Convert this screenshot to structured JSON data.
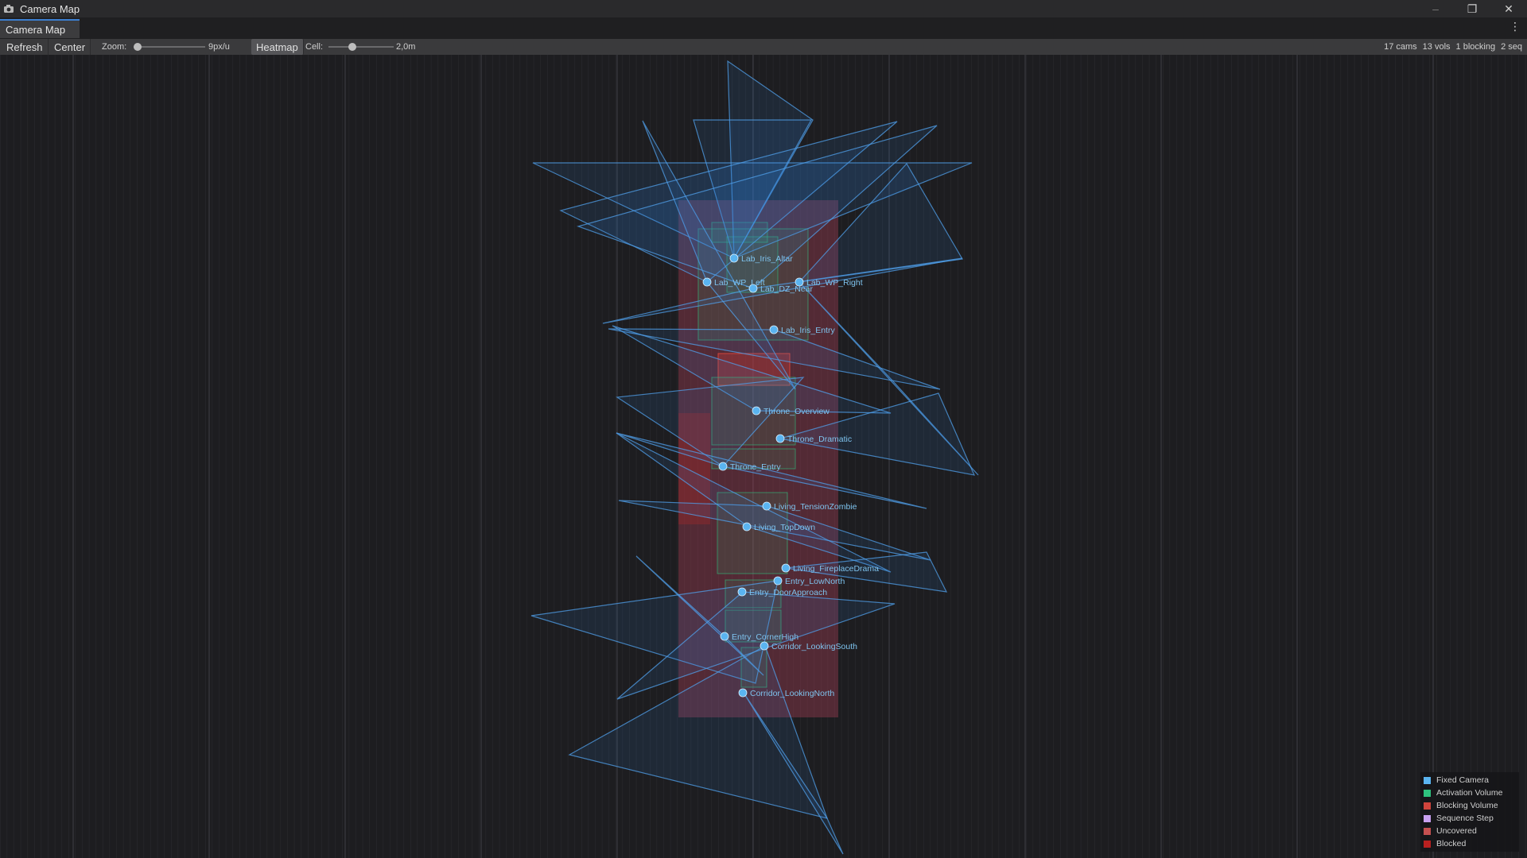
{
  "window": {
    "title": "Camera Map",
    "minimize": "–",
    "restore": "❐",
    "close": "✕"
  },
  "tab": {
    "label": "Camera Map",
    "menu": "⋮"
  },
  "toolbar": {
    "refresh": "Refresh",
    "center": "Center",
    "zoom_label": "Zoom:",
    "zoom_value": "9px/u",
    "zoom_fraction": 0.0,
    "heatmap": "Heatmap",
    "heatmap_active": true,
    "cell_label": "Cell:",
    "cell_value": "2,0m",
    "cell_fraction": 0.35
  },
  "stats": {
    "cams": "17 cams",
    "vols": "13 vols",
    "blocking": "1 blocking",
    "seq": "2 seq"
  },
  "colors": {
    "camera": "#4aa8e8",
    "camera_label": "#7ec3ee",
    "activation": "#2ec27e",
    "blocking": "#c0403a",
    "sequence": "#c8a0f0",
    "uncovered": "#c04848",
    "blocked": "#b02020"
  },
  "cameras": [
    "Lab_Iris_Altar",
    "Lab_WP_Left",
    "Lab_WP_Right",
    "Lab_DZ_Near",
    "Lab_Iris_Entry",
    "Throne_Overview",
    "Throne_Dramatic",
    "Throne_Entry",
    "Living_TensionZombie",
    "Living_TopDown",
    "Living_FireplaceDrama",
    "Entry_LowNorth",
    "Entry_DoorApproach",
    "Entry_CornerHigh",
    "Corridor_LookingSouth",
    "Corridor_LookingNorth"
  ],
  "legend": [
    {
      "label": "Fixed Camera",
      "color": "#5ab4f0"
    },
    {
      "label": "Activation Volume",
      "color": "#2ec27e"
    },
    {
      "label": "Blocking Volume",
      "color": "#d0443c"
    },
    {
      "label": "Sequence Step",
      "color": "#c8a0f0"
    },
    {
      "label": "Uncovered",
      "color": "#c45050"
    },
    {
      "label": "Blocked",
      "color": "#b82020"
    }
  ]
}
